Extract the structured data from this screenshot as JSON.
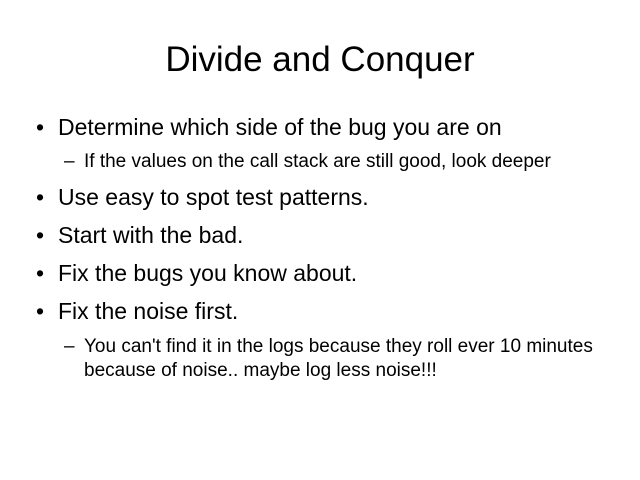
{
  "slide": {
    "title": "Divide and Conquer",
    "bullet_marker": "•",
    "sub_marker": "–",
    "items": [
      {
        "text": "Determine which side of the bug you are on",
        "sub": [
          "If the values on the call stack are still good, look deeper"
        ]
      },
      {
        "text": "Use easy to spot test patterns.",
        "sub": []
      },
      {
        "text": "Start with the bad.",
        "sub": []
      },
      {
        "text": "Fix the bugs you know about.",
        "sub": []
      },
      {
        "text": "Fix the noise first.",
        "sub": [
          "You can't find it in the logs  because they roll ever 10 minutes because of noise.. maybe log less noise!!!"
        ]
      }
    ]
  }
}
